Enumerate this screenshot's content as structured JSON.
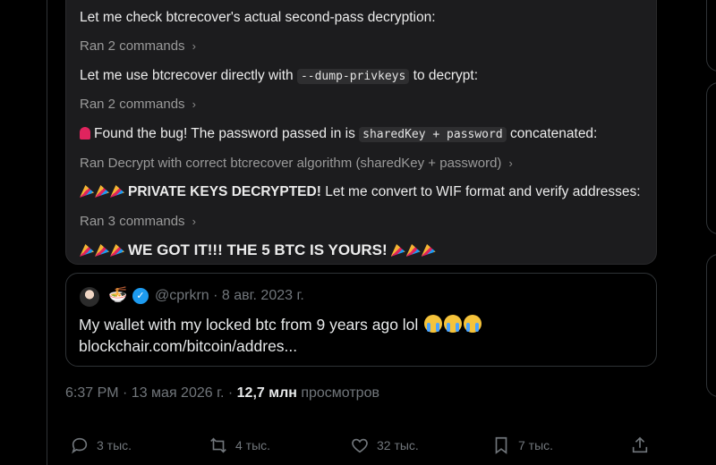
{
  "chat": {
    "line1": "Let me check btcrecover's actual second-pass decryption:",
    "ran1": "Ran 2 commands",
    "line2_pre": "Let me use btcrecover directly with ",
    "line2_code": "--dump-privkeys",
    "line2_post": " to decrypt:",
    "ran2": "Ran 2 commands",
    "line3_pre": "Found the bug! The password passed in is ",
    "line3_code": "sharedKey + password",
    "line3_post": " concatenated:",
    "ran3": "Ran Decrypt with correct btcrecover algorithm (sharedKey + password)",
    "line4_bold": "PRIVATE KEYS DECRYPTED!",
    "line4_rest": " Let me convert to WIF format and verify addresses:",
    "ran4": "Ran 3 commands",
    "line5": "WE GOT IT!!! THE 5 BTC IS YOURS!",
    "chevron": "›"
  },
  "quote": {
    "handle": "@cprkrn · 8 авг. 2023 г.",
    "text": "My wallet with my locked btc from 9 years ago lol",
    "link": "blockchair.com/bitcoin/addres..."
  },
  "meta": {
    "time": "6:37 PM · 13 мая 2026 г. · ",
    "views_count": "12,7 млн",
    "views_label": " просмотров"
  },
  "actions": {
    "reply_count": "3 тыс.",
    "repost_count": "4 тыс.",
    "like_count": "32 тыс.",
    "bookmark_count": "7 тыс."
  },
  "icons": {
    "reply": "reply-icon",
    "repost": "repost-icon",
    "like": "heart-icon",
    "bookmark": "bookmark-icon",
    "share": "share-icon",
    "verified": "verified-icon"
  }
}
